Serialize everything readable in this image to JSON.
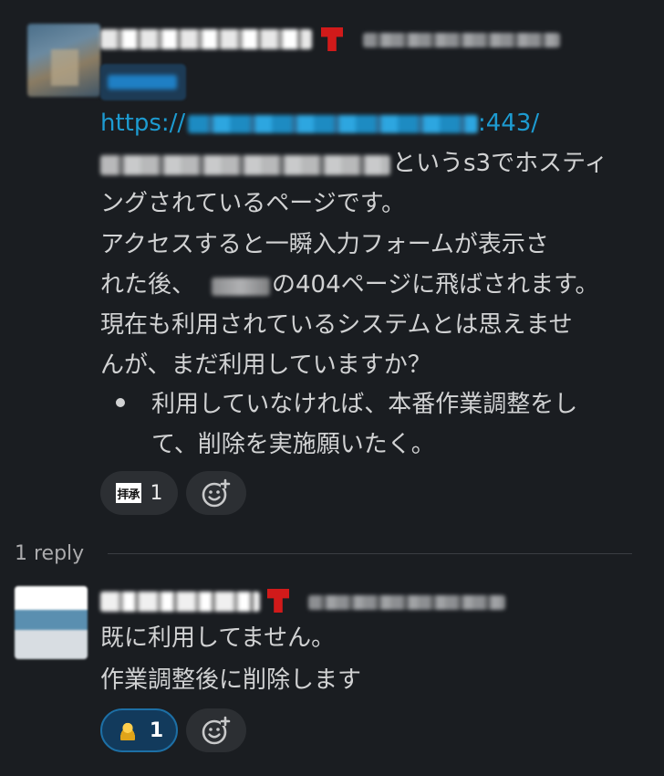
{
  "parent_message": {
    "link_url_prefix": "https://",
    "link_url_suffix": ":443/",
    "text_line_1_suffix": "というs3でホスティ",
    "text_line_2": "ングされているページです。",
    "text_line_3": "アクセスすると一瞬入力フォームが表示さ",
    "text_line_4_suffix": "の404ページに飛ばされます。",
    "text_line_4_prefix": "れた後、",
    "text_line_5": "現在も利用されているシステムとは思えませ",
    "text_line_6": "んが、まだ利用していますか？",
    "bullet_line_1": "利用していなければ、本番作業調整をし",
    "bullet_line_2": "て、削除を実施願いたく。",
    "reaction": {
      "emoji_label": "拝承",
      "count": "1"
    },
    "add_reaction_icon": "add-emoji-icon"
  },
  "thread": {
    "reply_count": "1 reply"
  },
  "reply_message": {
    "text_line_1": "既に利用してません。",
    "text_line_2": "作業調整後に削除します",
    "reaction": {
      "emoji_name": "bowing-person-icon",
      "count": "1"
    },
    "add_reaction_icon": "add-emoji-icon"
  },
  "colors": {
    "background": "#1a1d21",
    "text": "#d1d2d3",
    "link": "#1d9bd1",
    "reaction_selected_bg": "#123a5c",
    "reaction_selected_border": "#1d6fa5"
  }
}
